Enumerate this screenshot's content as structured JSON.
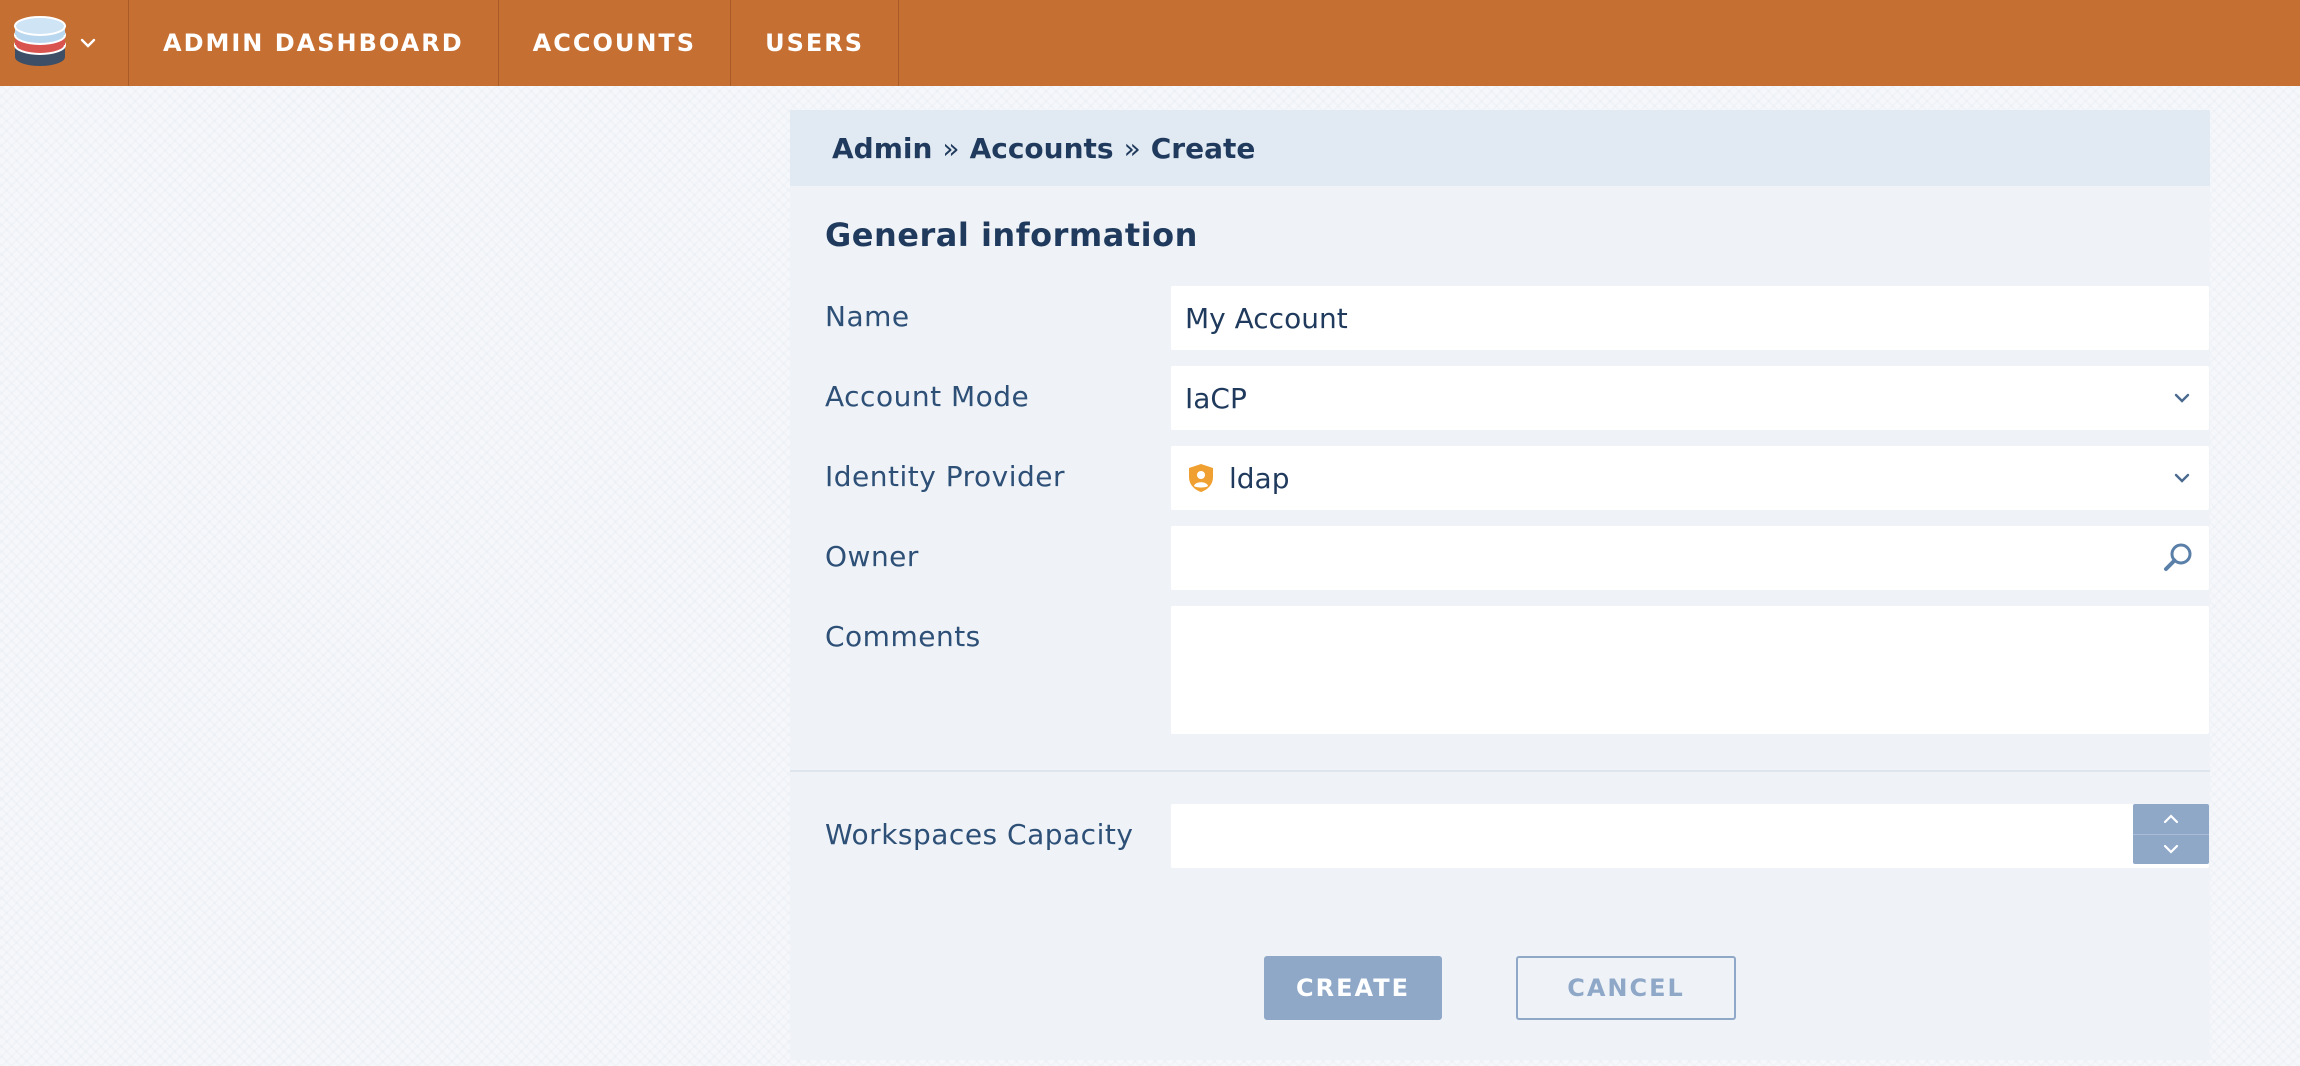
{
  "nav": {
    "items": [
      {
        "label": "ADMIN DASHBOARD"
      },
      {
        "label": "ACCOUNTS"
      },
      {
        "label": "USERS"
      }
    ]
  },
  "breadcrumb": [
    "Admin",
    "Accounts",
    "Create"
  ],
  "breadcrumb_separator": "»",
  "form": {
    "section_title": "General information",
    "name": {
      "label": "Name",
      "value": "My Account"
    },
    "account_mode": {
      "label": "Account Mode",
      "value": "IaCP"
    },
    "identity_provider": {
      "label": "Identity Provider",
      "value": "ldap",
      "icon": "user-shield-icon"
    },
    "owner": {
      "label": "Owner",
      "value": "",
      "icon": "search-icon"
    },
    "comments": {
      "label": "Comments",
      "value": ""
    },
    "workspaces_capacity": {
      "label": "Workspaces Capacity",
      "value": ""
    }
  },
  "actions": {
    "create": "CREATE",
    "cancel": "CANCEL"
  },
  "colors": {
    "topbar": "#c66f33",
    "panel": "#eff3f8",
    "breadcrumb_bg": "#e1e9f2",
    "button": "#8fa8c8",
    "text": "#1f3a5c",
    "identity_icon": "#f0a030"
  }
}
